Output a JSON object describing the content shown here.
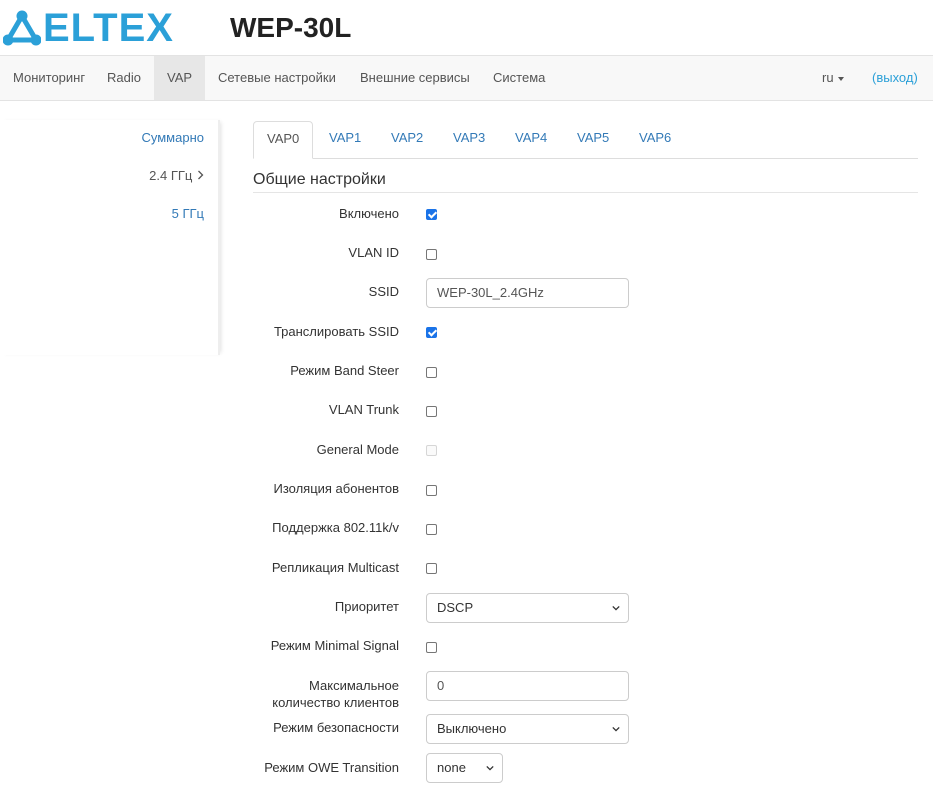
{
  "header": {
    "brand": "ELTEX",
    "device_title": "WEP-30L",
    "brand_color": "#2ba0d8"
  },
  "navbar": {
    "items": [
      {
        "label": "Мониторинг",
        "active": false
      },
      {
        "label": "Radio",
        "active": false
      },
      {
        "label": "VAP",
        "active": true
      },
      {
        "label": "Сетевые настройки",
        "active": false
      },
      {
        "label": "Внешние сервисы",
        "active": false
      },
      {
        "label": "Система",
        "active": false
      }
    ],
    "language": "ru",
    "logout": "(выход)"
  },
  "sidebar": {
    "items": [
      {
        "label": "Суммарно",
        "link": true
      },
      {
        "label": "2.4 ГГц",
        "link": false,
        "icon": "chevron-right-icon"
      },
      {
        "label": "5 ГГц",
        "link": true
      }
    ]
  },
  "tabs": [
    "VAP0",
    "VAP1",
    "VAP2",
    "VAP3",
    "VAP4",
    "VAP5",
    "VAP6"
  ],
  "active_tab": "VAP0",
  "section_title": "Общие настройки",
  "form": {
    "enabled": {
      "label": "Включено",
      "checked": true
    },
    "vlan_id": {
      "label": "VLAN ID",
      "checked": false
    },
    "ssid": {
      "label": "SSID",
      "value": "WEP-30L_2.4GHz"
    },
    "broadcast_ssid": {
      "label": "Транслировать SSID",
      "checked": true
    },
    "band_steer": {
      "label": "Режим Band Steer",
      "checked": false
    },
    "vlan_trunk": {
      "label": "VLAN Trunk",
      "checked": false
    },
    "general_mode": {
      "label": "General Mode",
      "checked": false,
      "disabled": true
    },
    "client_isolation": {
      "label": "Изоляция абонентов",
      "checked": false
    },
    "support_80211kv": {
      "label": "Поддержка 802.11k/v",
      "checked": false
    },
    "multicast_replication": {
      "label": "Репликация Multicast",
      "checked": false
    },
    "priority": {
      "label": "Приоритет",
      "value": "DSCP"
    },
    "minimal_signal": {
      "label": "Режим Minimal Signal",
      "checked": false
    },
    "max_clients": {
      "label_line1": "Максимальное",
      "label_line2": "количество клиентов",
      "value": "0"
    },
    "security_mode": {
      "label": "Режим безопасности",
      "value": "Выключено"
    },
    "owe_transition": {
      "label": "Режим OWE Transition",
      "value": "none"
    }
  }
}
